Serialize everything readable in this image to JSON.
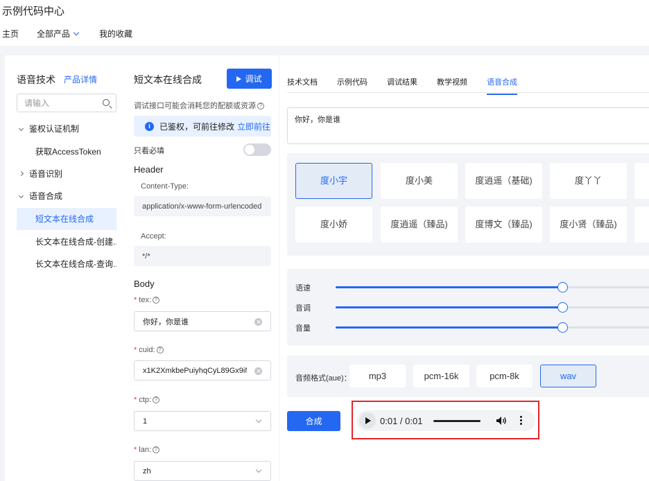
{
  "page": {
    "title": "示例代码中心"
  },
  "nav": {
    "home": "主页",
    "all_products": "全部产品",
    "favorites": "我的收藏"
  },
  "left": {
    "title": "语音技术",
    "detail_link": "产品详情",
    "search_placeholder": "请输入",
    "tree": [
      {
        "label": "鉴权认证机制",
        "expanded": true
      },
      {
        "label": "获取AccessToken"
      },
      {
        "label": "语音识别",
        "expanded": false
      },
      {
        "label": "语音合成",
        "expanded": true
      },
      {
        "label": "短文本在线合成",
        "active": true
      },
      {
        "label": "长文本在线合成-创建..."
      },
      {
        "label": "长文本在线合成-查询..."
      }
    ]
  },
  "middle": {
    "title": "短文本在线合成",
    "debug_button": "调试",
    "note": "调试接口可能会消耗您的配额或资源",
    "auth_text": "已鉴权，可前往修改",
    "auth_link": "立即前往",
    "required_only": "只看必填",
    "header_section": "Header",
    "content_type_label": "Content-Type:",
    "content_type_value": "application/x-www-form-urlencoded",
    "accept_label": "Accept:",
    "accept_value": "*/*",
    "body_section": "Body",
    "tex_label": "tex:",
    "tex_value": "你好，你是谁",
    "cuid_label": "cuid:",
    "cuid_value": "x1K2XmkbePuiyhqCyL89Gx9iN",
    "ctp_label": "ctp:",
    "ctp_value": "1",
    "lan_label": "lan:",
    "lan_value": "zh"
  },
  "right": {
    "tabs": [
      "技术文档",
      "示例代码",
      "调试结果",
      "教学视频",
      "语音合成"
    ],
    "active_tab": 4,
    "input_text": "你好，你是谁",
    "voices": [
      {
        "label": "度小宇",
        "selected": true
      },
      {
        "label": "度小美"
      },
      {
        "label": "度逍遥（基础)"
      },
      {
        "label": "度丫丫"
      },
      {
        "label": "度小娇"
      },
      {
        "label": "度逍遥（臻品)"
      },
      {
        "label": "度博文（臻品)"
      },
      {
        "label": "度小贤（臻品)"
      }
    ],
    "sliders": [
      {
        "label": "语速",
        "value": 0.71
      },
      {
        "label": "音调",
        "value": 0.71
      },
      {
        "label": "音量",
        "value": 0.71
      }
    ],
    "format_label": "音频格式(aue)：",
    "formats": [
      "mp3",
      "pcm-16k",
      "pcm-8k",
      "wav"
    ],
    "selected_format": "wav",
    "synth_button": "合成",
    "player": {
      "time": "0:01 / 0:01"
    }
  },
  "colors": {
    "accent": "#2468f2",
    "highlight": "#e4232b"
  }
}
